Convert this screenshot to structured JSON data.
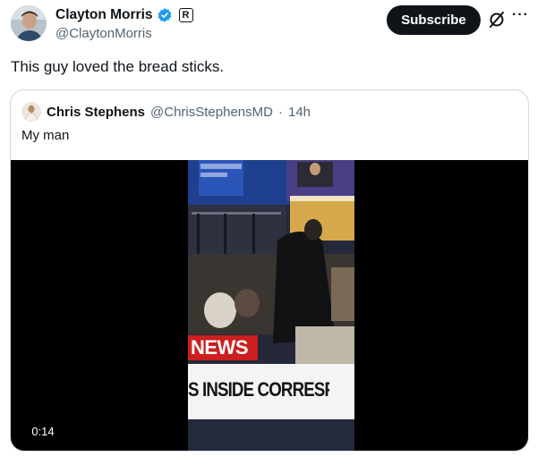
{
  "post": {
    "author_name": "Clayton Morris",
    "affiliate_badge": "R",
    "handle": "@ClaytonMorris",
    "subscribe_label": "Subscribe",
    "more_label": "···",
    "text": "This guy loved the bread sticks."
  },
  "quote": {
    "author_name": "Chris Stephens",
    "handle": "@ChrisStephensMD",
    "separator": "·",
    "time": "14h",
    "text": "My man",
    "video": {
      "duration": "0:14",
      "news_tag": "NEWS",
      "chyron": "S INSIDE CORRESPON"
    }
  },
  "colors": {
    "verified_blue": "#1d9bf0",
    "subscribe_bg": "#0f1419",
    "secondary_text": "#536471",
    "news_red": "#cc1f1f"
  },
  "icons": {
    "verified": "verified-badge-icon",
    "grok": "grok-icon",
    "more": "more-icon"
  }
}
